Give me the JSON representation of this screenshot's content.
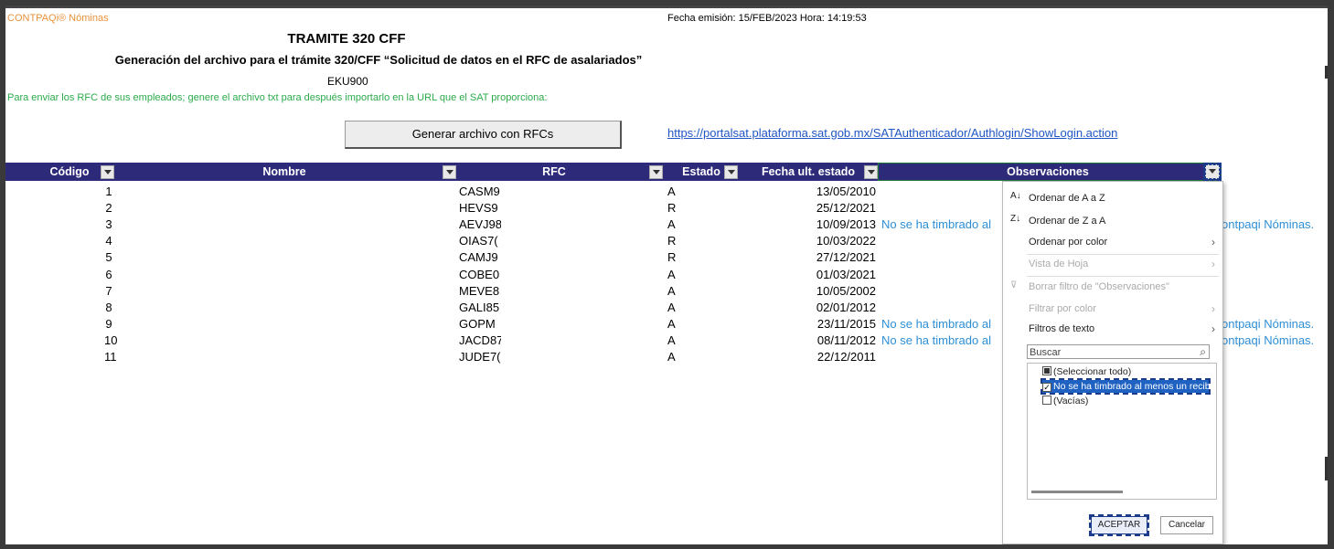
{
  "app": {
    "brand": "CONTPAQi® Nóminas",
    "emision": "Fecha emisión: 15/FEB/2023  Hora: 14:19:53"
  },
  "report": {
    "title": "TRAMITE 320 CFF",
    "subtitle": "Generación del archivo para el trámite 320/CFF “Solicitud de datos en el RFC de asalariados”",
    "code": "EKU900",
    "note": "Para enviar los RFC de sus empleados; genere el archivo txt para después importarlo en la  URL que el SAT proporciona:",
    "button_label": "Generar archivo con RFCs",
    "url": "https://portalsat.plataforma.sat.gob.mx/SATAuthenticador/Authlogin/ShowLogin.action"
  },
  "table": {
    "headers": {
      "codigo": "Código",
      "nombre": "Nombre",
      "rfc": "RFC",
      "estado": "Estado",
      "fecha": "Fecha ult. estado",
      "obs": "Observaciones"
    },
    "rows": [
      {
        "codigo": "1",
        "rfc": "CASM9",
        "estado": "A",
        "fecha": "13/05/2010",
        "obs": "",
        "obs2": ""
      },
      {
        "codigo": "2",
        "rfc": "HEVS9",
        "estado": "R",
        "fecha": "25/12/2021",
        "obs": "",
        "obs2": ""
      },
      {
        "codigo": "3",
        "rfc": "AEVJ98",
        "estado": "A",
        "fecha": "10/09/2013",
        "obs": "No se ha timbrado al",
        "obs2": "ontpaqi Nóminas."
      },
      {
        "codigo": "4",
        "rfc": "OIAS7(",
        "estado": "R",
        "fecha": "10/03/2022",
        "obs": "",
        "obs2": ""
      },
      {
        "codigo": "5",
        "rfc": "CAMJ9",
        "estado": "R",
        "fecha": "27/12/2021",
        "obs": "",
        "obs2": ""
      },
      {
        "codigo": "6",
        "rfc": "COBE0",
        "estado": "A",
        "fecha": "01/03/2021",
        "obs": "",
        "obs2": ""
      },
      {
        "codigo": "7",
        "rfc": "MEVE8",
        "estado": "A",
        "fecha": "10/05/2002",
        "obs": "",
        "obs2": ""
      },
      {
        "codigo": "8",
        "rfc": "GALI85",
        "estado": "A",
        "fecha": "02/01/2012",
        "obs": "",
        "obs2": ""
      },
      {
        "codigo": "9",
        "rfc": "GOPM",
        "estado": "A",
        "fecha": "23/11/2015",
        "obs": "No se ha timbrado al",
        "obs2": "ontpaqi Nóminas."
      },
      {
        "codigo": "10",
        "rfc": "JACD87",
        "estado": "A",
        "fecha": "08/11/2012",
        "obs": "No se ha timbrado al",
        "obs2": "ontpaqi Nóminas."
      },
      {
        "codigo": "11",
        "rfc": "JUDE7(",
        "estado": "A",
        "fecha": "22/12/2011",
        "obs": "",
        "obs2": ""
      }
    ]
  },
  "filter_menu": {
    "sort_az": "Ordenar de A a Z",
    "sort_za": "Ordenar de Z a A",
    "sort_color": "Ordenar por color",
    "sheet_view": "Vista de Hoja",
    "clear_filter": "Borrar filtro de \"Observaciones\"",
    "filter_color": "Filtrar por color",
    "text_filters": "Filtros de texto",
    "search_placeholder": "Buscar",
    "items": [
      "(Seleccionar todo)",
      "No se ha timbrado al menos un recibo",
      "(Vacías)"
    ],
    "ok": "ACEPTAR",
    "cancel": "Cancelar"
  }
}
